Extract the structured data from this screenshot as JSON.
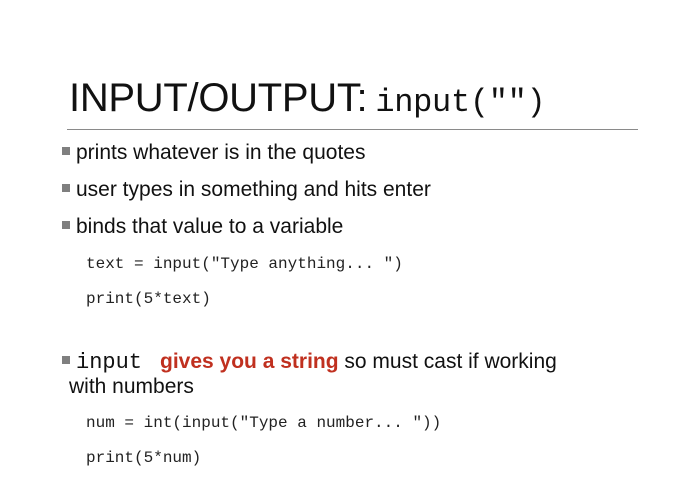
{
  "slide": {
    "title_text": "INPUT/OUTPUT:",
    "title_code": "input(\"\")",
    "bullets": [
      "prints whatever is in the quotes",
      "user types in something and hits enter",
      "binds that value to a variable"
    ],
    "code_block_1": [
      "text = input(\"Type anything... \")",
      "print(5*text)"
    ],
    "bullet4": {
      "code": "input",
      "highlight": "gives you a string",
      "rest": " so must cast if working",
      "continuation": "with numbers"
    },
    "code_block_2": [
      "num = int(input(\"Type a number... \"))",
      "print(5*num)"
    ],
    "colors": {
      "highlight": "#c0301f",
      "bullet_square": "#7f7f7f",
      "rule": "#8a8a8a"
    }
  }
}
